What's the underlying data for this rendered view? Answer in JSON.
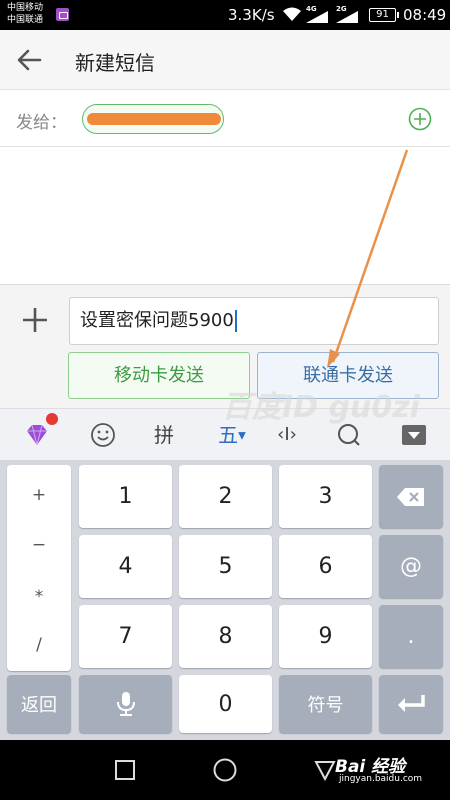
{
  "status_bar": {
    "carrier_1": "中国移动",
    "carrier_2": "中国联通",
    "speed": "3.3K/s",
    "net_1": "4G",
    "net_2": "2G",
    "battery": "91",
    "time": "08:49"
  },
  "header": {
    "title": "新建短信",
    "back_icon": "arrow-left-icon"
  },
  "recipient": {
    "label": "发给：",
    "chip_value": "redacted",
    "add_icon": "plus-circle-icon"
  },
  "compose": {
    "attach_icon": "plus-icon",
    "message_text": "设置密保问题5900",
    "send_mobile_label": "移动卡发送",
    "send_unicom_label": "联通卡发送"
  },
  "watermark": "百度ID gu0zi",
  "keyboard_toolbar": {
    "gem_icon": "gem-icon",
    "emoji_icon": "smiley-icon",
    "pinyin_label": "拼",
    "wubi_label": "五",
    "cursor_label": "‹I›",
    "search_icon": "search-icon",
    "hide_icon": "keyboard-hide-icon"
  },
  "keyboard": {
    "symbols": [
      "+",
      "−",
      "*",
      "/"
    ],
    "digits": [
      "1",
      "2",
      "3",
      "4",
      "5",
      "6",
      "7",
      "8",
      "9",
      "0"
    ],
    "delete_icon": "backspace-icon",
    "at_label": "@",
    "dot_label": ".",
    "back_label": "返回",
    "mic_icon": "microphone-icon",
    "symbols_label": "符号",
    "enter_icon": "enter-icon"
  },
  "nav_bar": {
    "recent_icon": "square-icon",
    "home_icon": "circle-icon",
    "back_icon": "triangle-back-icon",
    "brand_1": "Bai 经验",
    "brand_2": "jingyan.baidu.com"
  },
  "colors": {
    "green": "#3e9b44",
    "blue": "#3a6ea3",
    "orange": "#ef8a3a",
    "keyboard_dark": "#a6adbb"
  }
}
